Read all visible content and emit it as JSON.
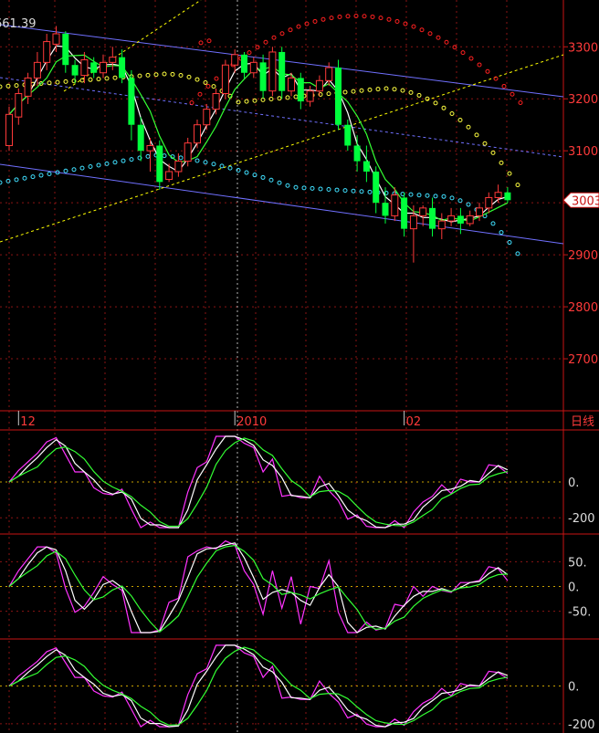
{
  "chart_data": {
    "type": "candlestick",
    "corner_label": "661.39",
    "timeframe_label": "日线",
    "current_price_label": "3003",
    "price_axis": {
      "ylim": [
        2600,
        3390
      ],
      "ticks": [
        2700,
        2800,
        2900,
        3000,
        3100,
        3200,
        3300
      ],
      "tick_labels": [
        "2700",
        "2800",
        "2900",
        "",
        "3100",
        "3200",
        "3300"
      ]
    },
    "date_labels": [
      {
        "label": "12",
        "bar": 1
      },
      {
        "label": "2010",
        "bar": 24
      },
      {
        "label": "02",
        "bar": 42
      }
    ],
    "candles": [
      [
        3110,
        3185,
        3100,
        3170
      ],
      [
        3165,
        3220,
        3150,
        3210
      ],
      [
        3205,
        3250,
        3190,
        3240
      ],
      [
        3240,
        3290,
        3225,
        3270
      ],
      [
        3270,
        3325,
        3255,
        3310
      ],
      [
        3305,
        3340,
        3290,
        3325
      ],
      [
        3325,
        3330,
        3250,
        3265
      ],
      [
        3265,
        3275,
        3230,
        3245
      ],
      [
        3245,
        3290,
        3230,
        3275
      ],
      [
        3270,
        3280,
        3240,
        3250
      ],
      [
        3250,
        3285,
        3240,
        3270
      ],
      [
        3270,
        3300,
        3255,
        3280
      ],
      [
        3280,
        3295,
        3230,
        3240
      ],
      [
        3240,
        3255,
        3120,
        3150
      ],
      [
        3150,
        3165,
        3080,
        3100
      ],
      [
        3100,
        3125,
        3060,
        3110
      ],
      [
        3110,
        3120,
        3025,
        3040
      ],
      [
        3045,
        3075,
        3040,
        3060
      ],
      [
        3060,
        3095,
        3050,
        3080
      ],
      [
        3080,
        3125,
        3070,
        3115
      ],
      [
        3115,
        3160,
        3105,
        3150
      ],
      [
        3150,
        3190,
        3140,
        3180
      ],
      [
        3180,
        3220,
        3170,
        3210
      ],
      [
        3210,
        3275,
        3200,
        3265
      ],
      [
        3265,
        3295,
        3250,
        3285
      ],
      [
        3285,
        3290,
        3240,
        3250
      ],
      [
        3250,
        3280,
        3240,
        3270
      ],
      [
        3270,
        3285,
        3200,
        3215
      ],
      [
        3215,
        3300,
        3205,
        3290
      ],
      [
        3290,
        3300,
        3200,
        3215
      ],
      [
        3215,
        3250,
        3205,
        3240
      ],
      [
        3240,
        3250,
        3180,
        3195
      ],
      [
        3195,
        3225,
        3185,
        3215
      ],
      [
        3215,
        3245,
        3205,
        3235
      ],
      [
        3235,
        3270,
        3225,
        3260
      ],
      [
        3260,
        3275,
        3140,
        3150
      ],
      [
        3150,
        3160,
        3100,
        3110
      ],
      [
        3110,
        3130,
        3060,
        3080
      ],
      [
        3080,
        3110,
        3040,
        3060
      ],
      [
        3060,
        3070,
        2980,
        3000
      ],
      [
        3000,
        3030,
        2960,
        2975
      ],
      [
        2975,
        3030,
        2965,
        3015
      ],
      [
        3010,
        3020,
        2935,
        2950
      ],
      [
        2950,
        2995,
        2885,
        2975
      ],
      [
        2975,
        2995,
        2955,
        2990
      ],
      [
        2990,
        3010,
        2935,
        2950
      ],
      [
        2950,
        2980,
        2930,
        2965
      ],
      [
        2965,
        2990,
        2955,
        2975
      ],
      [
        2975,
        2990,
        2940,
        2960
      ],
      [
        2960,
        2985,
        2955,
        2975
      ],
      [
        2975,
        3000,
        2965,
        2990
      ],
      [
        2990,
        3020,
        2980,
        3010
      ],
      [
        3010,
        3035,
        3000,
        3020
      ],
      [
        3020,
        3030,
        3000,
        3005
      ]
    ],
    "indicator_panels": [
      {
        "ylim": [
          -260,
          260
        ],
        "tick_values": [
          0,
          -200
        ],
        "tick_labels": [
          "0.",
          "-200"
        ]
      },
      {
        "ylim": [
          -95,
          95
        ],
        "tick_values": [
          50,
          0,
          -50
        ],
        "tick_labels": [
          "50.",
          "0.",
          "-50."
        ]
      },
      {
        "ylim": [
          -220,
          220
        ],
        "tick_values": [
          0,
          -200
        ],
        "tick_labels": [
          "0.",
          "-200"
        ]
      }
    ],
    "colors": {
      "up": "#ff3a3a",
      "down": "#00ff3c",
      "ma_fast": "#ffffff",
      "ma_slow": "#33ff33",
      "osc_fast": "#ff33ff",
      "osc_mid": "#ffffff",
      "osc_slow": "#33ff33",
      "sar_top": "#ff2020",
      "sar_mid": "#ffff40",
      "sar_low": "#40e0ff",
      "channel": "#7070ff",
      "trend": "#ffff00",
      "grid": "#8a1414",
      "axis": "#c81414",
      "label": "#ff3a3a"
    }
  }
}
